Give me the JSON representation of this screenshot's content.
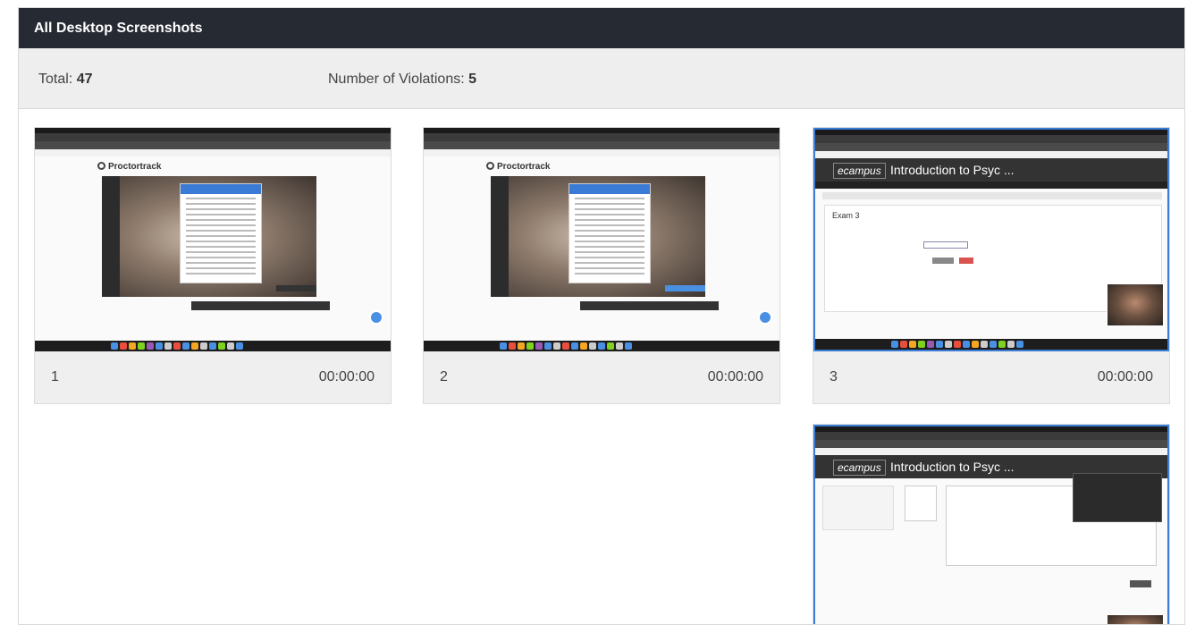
{
  "panel": {
    "title": "All Desktop Screenshots"
  },
  "stats": {
    "total_label": "Total:",
    "total_value": "47",
    "violations_label": "Number of Violations:",
    "violations_value": "5"
  },
  "screenshots": [
    {
      "number": "1",
      "time": "00:00:00",
      "content": "proctortrack-agreement",
      "highlighted": false
    },
    {
      "number": "2",
      "time": "00:00:00",
      "content": "proctortrack-agreement",
      "highlighted": false
    },
    {
      "number": "3",
      "time": "00:00:00",
      "content": "ecampus-exam",
      "highlighted": true
    },
    {
      "number": "",
      "time": "",
      "content": "ecampus-quiz",
      "highlighted": true
    }
  ],
  "thumb_text": {
    "proctortrack_logo": "Proctortrack",
    "ecampus_logo": "ecampus",
    "course_title": "Introduction to Psyc ...",
    "exam_heading": "Exam 3"
  },
  "colors": {
    "header_bg": "#262a33",
    "highlight_border": "#3a7bd5"
  }
}
